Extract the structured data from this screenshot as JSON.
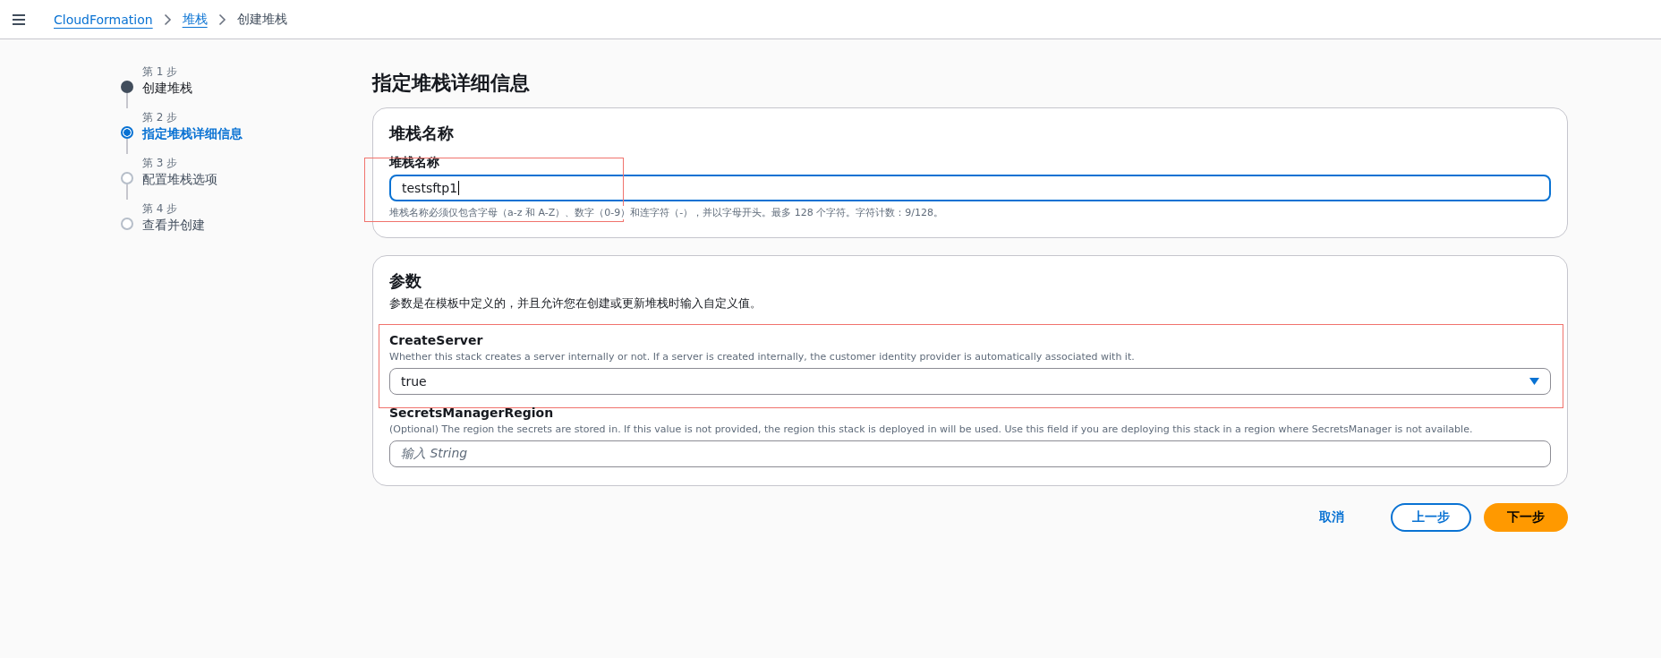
{
  "breadcrumbs": [
    {
      "label": "CloudFormation",
      "kind": "link"
    },
    {
      "label": "堆栈",
      "kind": "link"
    },
    {
      "label": "创建堆栈",
      "kind": "current"
    }
  ],
  "steps": [
    {
      "number": "第 1 步",
      "title": "创建堆栈",
      "kind": "done",
      "selected": false
    },
    {
      "number": "第 2 步",
      "title": "指定堆栈详细信息",
      "kind": "current",
      "selected": true
    },
    {
      "number": "第 3 步",
      "title": "配置堆栈选项",
      "kind": "pending",
      "selected": false
    },
    {
      "number": "第 4 步",
      "title": "查看并创建",
      "kind": "pending",
      "selected": false
    }
  ],
  "page_title": "指定堆栈详细信息",
  "stack_name_card": {
    "heading": "堆栈名称",
    "label": "堆栈名称",
    "value": "testsftp1",
    "focused": true,
    "highlighted": true,
    "hint": "堆栈名称必须仅包含字母（a-z 和 A-Z）、数字（0-9）和连字符（-），并以字母开头。最多 128 个字符。字符计数：9/128。"
  },
  "parameters_card": {
    "heading": "参数",
    "description": "参数是在模板中定义的，并且允许您在创建或更新堆栈时输入自定义值。",
    "fields": [
      {
        "kind": "select",
        "label": "CreateServer",
        "description": "Whether this stack creates a server internally or not. If a server is created internally, the customer identity provider is automatically associated with it.",
        "value": "true",
        "highlighted": true
      },
      {
        "kind": "text",
        "label": "SecretsManagerRegion",
        "description": "(Optional) The region the secrets are stored in. If this value is not provided, the region this stack is deployed in will be used. Use this field if you are deploying this stack in a region where SecretsManager is not available.",
        "placeholder": "输入 String",
        "highlighted": false
      }
    ]
  },
  "actions": [
    {
      "label": "取消",
      "kind": "link"
    },
    {
      "label": "上一步",
      "kind": "normal"
    },
    {
      "label": "下一步",
      "kind": "primary"
    }
  ]
}
